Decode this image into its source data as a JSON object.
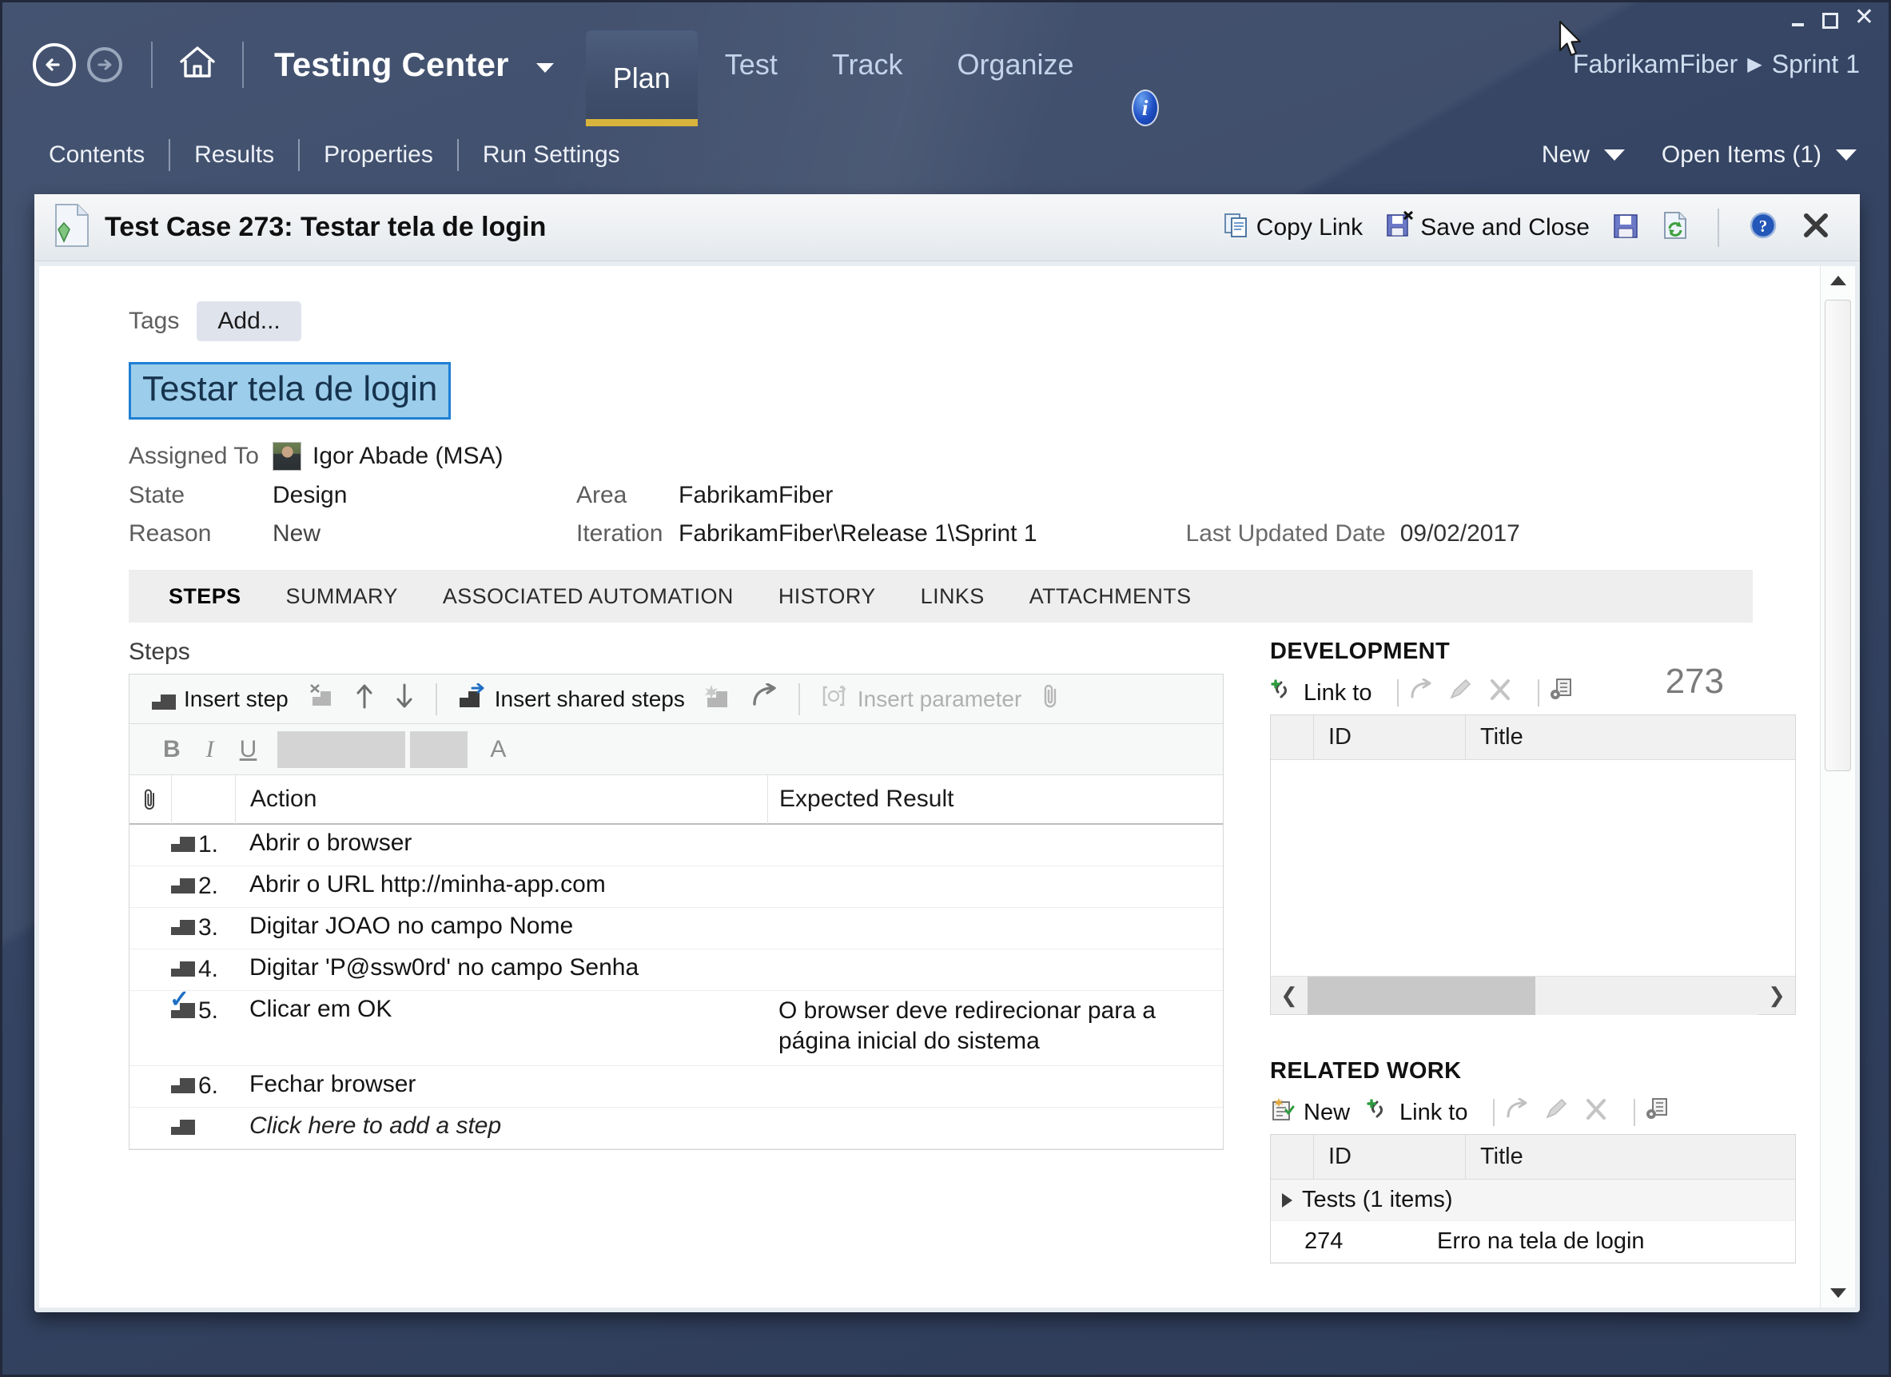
{
  "window": {
    "minimize": "minimize",
    "maximize": "maximize",
    "close": "close"
  },
  "topnav": {
    "app_title": "Testing Center",
    "back": "Back",
    "forward": "Forward",
    "home": "Home",
    "tabs": [
      {
        "label": "Plan",
        "active": true
      },
      {
        "label": "Test",
        "active": false
      },
      {
        "label": "Track",
        "active": false
      },
      {
        "label": "Organize",
        "active": false
      }
    ],
    "info_glyph": "i",
    "breadcrumb": {
      "project": "FabrikamFiber",
      "separator": "▶",
      "iteration": "Sprint 1"
    },
    "accent_color": "#d9b43d"
  },
  "subnav": {
    "items": [
      "Contents",
      "Results",
      "Properties",
      "Run Settings"
    ],
    "new_label": "New",
    "open_items_label": "Open Items (1)"
  },
  "workitem": {
    "header_title": "Test Case 273: Testar tela de login",
    "actions": {
      "copy_link": "Copy Link",
      "save_and_close": "Save and Close",
      "save": "Save",
      "refresh": "Refresh",
      "help": "Help",
      "close": "Close"
    },
    "tags_label": "Tags",
    "tags_add": "Add...",
    "title_value": "Testar tela de login",
    "id": "273",
    "fields": {
      "assigned_to_label": "Assigned To",
      "assigned_to_value": "Igor Abade (MSA)",
      "state_label": "State",
      "state_value": "Design",
      "reason_label": "Reason",
      "reason_value": "New",
      "area_label": "Area",
      "area_value": "FabrikamFiber",
      "iteration_label": "Iteration",
      "iteration_value": "FabrikamFiber\\Release 1\\Sprint 1",
      "last_updated_label": "Last Updated Date",
      "last_updated_value": "09/02/2017"
    },
    "tabs": [
      {
        "label": "STEPS",
        "active": true
      },
      {
        "label": "SUMMARY",
        "active": false
      },
      {
        "label": "ASSOCIATED AUTOMATION",
        "active": false
      },
      {
        "label": "HISTORY",
        "active": false
      },
      {
        "label": "LINKS",
        "active": false
      },
      {
        "label": "ATTACHMENTS",
        "active": false
      }
    ]
  },
  "steps": {
    "section_label": "Steps",
    "toolbar": {
      "insert_step": "Insert step",
      "delete_step": "Delete step",
      "move_up": "Move up",
      "move_down": "Move down",
      "insert_shared_steps": "Insert shared steps",
      "create_shared_steps": "Create shared steps",
      "open_shared_steps": "Open shared steps",
      "insert_parameter": "Insert parameter",
      "attach_file": "Attach file"
    },
    "format_toolbar": {
      "bold": "B",
      "italic": "I",
      "underline": "U",
      "font_name": "",
      "font_size": "",
      "font_color": "A"
    },
    "columns": {
      "attachment": "",
      "number": "",
      "action": "Action",
      "expected": "Expected Result"
    },
    "rows": [
      {
        "num": "1.",
        "action": "Abrir o browser",
        "expected": "",
        "shared": false
      },
      {
        "num": "2.",
        "action": "Abrir o URL http://minha-app.com",
        "expected": "",
        "shared": false
      },
      {
        "num": "3.",
        "action": "Digitar JOAO no campo Nome",
        "expected": "",
        "shared": false
      },
      {
        "num": "4.",
        "action": "Digitar 'P@ssw0rd' no campo Senha",
        "expected": "",
        "shared": false
      },
      {
        "num": "5.",
        "action": "Clicar em OK",
        "expected": "O browser deve redirecionar para a página inicial do sistema",
        "shared": true
      },
      {
        "num": "6.",
        "action": "Fechar browser",
        "expected": "",
        "shared": false
      }
    ],
    "add_row_text": "Click here to add a step"
  },
  "development": {
    "title": "DEVELOPMENT",
    "link_to": "Link to",
    "open": "Open",
    "edit": "Edit",
    "remove": "Remove",
    "columns_options": "Column options",
    "columns": {
      "id": "ID",
      "title": "Title"
    },
    "rows": []
  },
  "related_work": {
    "title": "RELATED WORK",
    "new": "New",
    "link_to": "Link to",
    "open": "Open",
    "edit": "Edit",
    "remove": "Remove",
    "columns_options": "Column options",
    "columns": {
      "id": "ID",
      "title": "Title"
    },
    "groups": [
      {
        "label": "Tests (1 items)",
        "expanded": true,
        "rows": [
          {
            "id": "274",
            "title": "Erro na tela de login"
          }
        ]
      }
    ]
  }
}
